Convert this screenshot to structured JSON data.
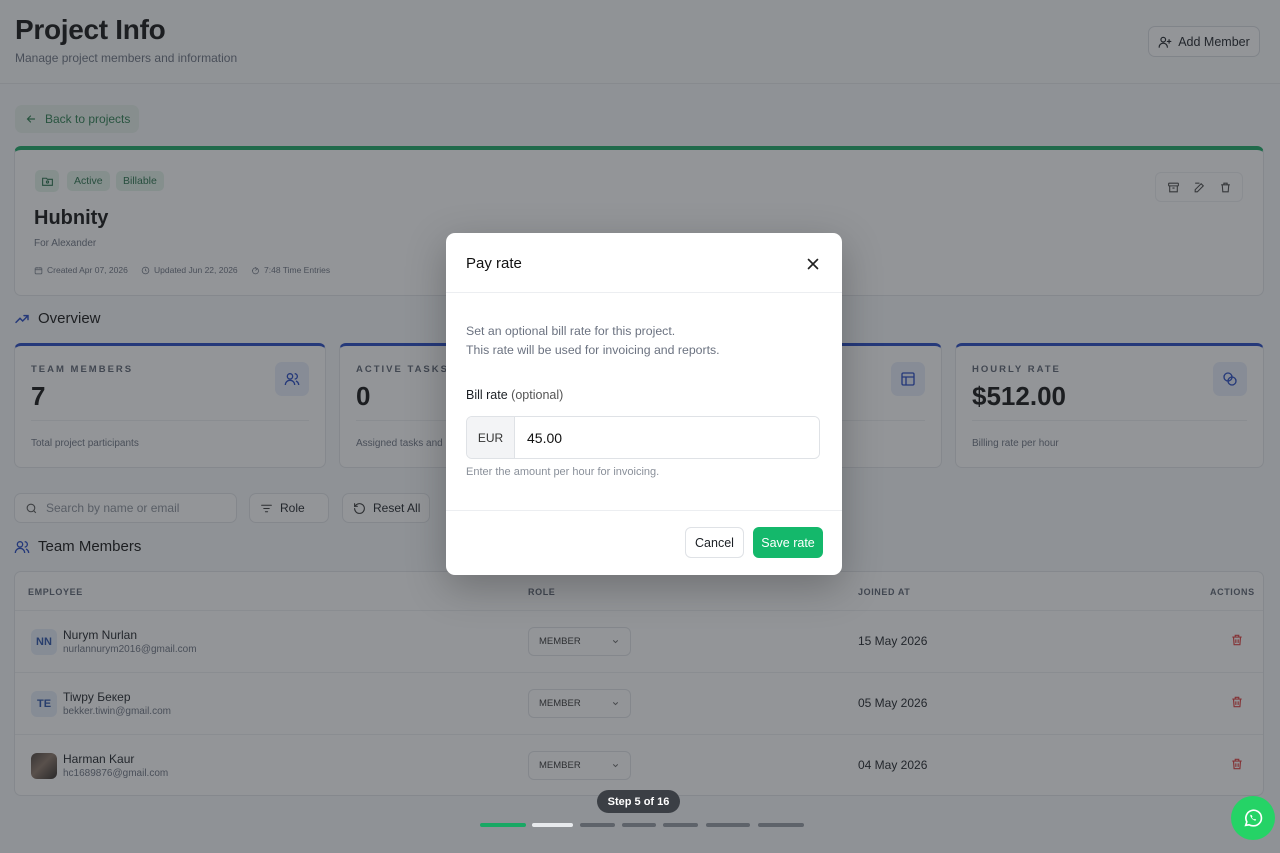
{
  "header": {
    "title": "Project Info",
    "subtitle": "Manage project members and information",
    "add_member_label": "Add Member"
  },
  "back_label": "Back to projects",
  "project": {
    "status_badge": "Active",
    "billing_badge": "Billable",
    "name": "Hubnity",
    "client": "For Alexander",
    "created": "Created Apr 07, 2026",
    "updated": "Updated Jun 22, 2026",
    "time_entries": "7:48 Time Entries"
  },
  "overview": {
    "title": "Overview",
    "cards": [
      {
        "label": "TEAM MEMBERS",
        "value": "7",
        "desc": "Total project participants",
        "icon": "users-icon"
      },
      {
        "label": "ACTIVE TASKS",
        "value": "0",
        "desc": "Assigned tasks and",
        "icon": "tasks-icon"
      },
      {
        "label": "",
        "value": "",
        "desc": "",
        "icon": "layout-icon"
      },
      {
        "label": "HOURLY RATE",
        "value": "$512.00",
        "desc": "Billing rate per hour",
        "icon": "coins-icon"
      }
    ]
  },
  "filters": {
    "search_placeholder": "Search by name or email",
    "role_label": "Role",
    "reset_label": "Reset All"
  },
  "team": {
    "title": "Team Members",
    "columns": [
      "EMPLOYEE",
      "ROLE",
      "JOINED AT",
      "ACTIONS"
    ],
    "rows": [
      {
        "initials": "NN",
        "name": "Nurym Nurlan",
        "email": "nurlannurym2016@gmail.com",
        "role": "MEMBER",
        "joined": "15 May 2026"
      },
      {
        "initials": "TE",
        "name": "Tiwpy Бекер",
        "email": "bekker.tiwin@gmail.com",
        "role": "MEMBER",
        "joined": "05 May 2026"
      },
      {
        "initials": "",
        "name": "Harman Kaur",
        "email": "hc1689876@gmail.com",
        "role": "MEMBER",
        "joined": "04 May 2026"
      }
    ]
  },
  "modal": {
    "title": "Pay rate",
    "desc_line1": "Set an optional bill rate for this project.",
    "desc_line2": "This rate will be used for invoicing and reports.",
    "field_label": "Bill rate",
    "field_optional": "(optional)",
    "currency": "EUR",
    "value": "45.00",
    "hint": "Enter the amount per hour for invoicing.",
    "cancel_label": "Cancel",
    "save_label": "Save rate"
  },
  "tour": {
    "step_label": "Step 5 of 16",
    "current_step": 5,
    "total_steps": 16
  },
  "colors": {
    "accent_green": "#14b86b",
    "accent_blue": "#2247c2",
    "danger": "#e03b3b"
  }
}
